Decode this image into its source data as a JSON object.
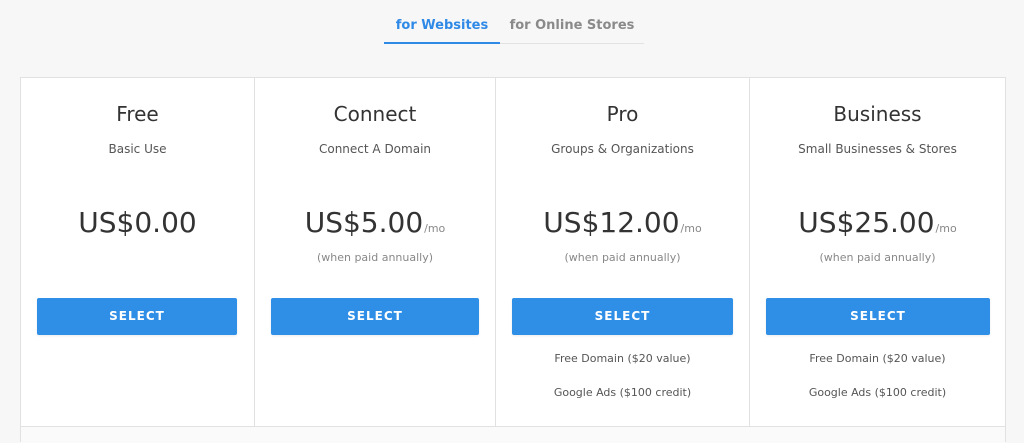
{
  "tabs": [
    {
      "label": "for Websites",
      "active": true
    },
    {
      "label": "for Online Stores",
      "active": false
    }
  ],
  "accent_color": "#2f8ee6",
  "plans": [
    {
      "name": "Free",
      "subtitle": "Basic Use",
      "price": "US$0.00",
      "per": "",
      "billing": "",
      "button_label": "SELECT",
      "features": []
    },
    {
      "name": "Connect",
      "subtitle": "Connect A Domain",
      "price": "US$5.00",
      "per": "/mo",
      "billing": "(when paid annually)",
      "button_label": "SELECT",
      "features": []
    },
    {
      "name": "Pro",
      "subtitle": "Groups & Organizations",
      "price": "US$12.00",
      "per": "/mo",
      "billing": "(when paid annually)",
      "button_label": "SELECT",
      "features": [
        "Free Domain ($20 value)",
        "Google Ads ($100 credit)"
      ]
    },
    {
      "name": "Business",
      "subtitle": "Small Businesses & Stores",
      "price": "US$25.00",
      "per": "/mo",
      "billing": "(when paid annually)",
      "button_label": "SELECT",
      "features": [
        "Free Domain ($20 value)",
        "Google Ads ($100 credit)"
      ]
    }
  ]
}
